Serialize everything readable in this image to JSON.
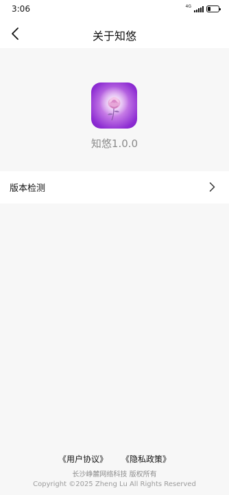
{
  "status_bar": {
    "time": "3:06",
    "network_label": "4G",
    "icons": [
      "signal-icon",
      "battery-icon"
    ],
    "battery_level": 0.25
  },
  "nav": {
    "title": "关于知悠",
    "back_icon": "chevron-left-icon"
  },
  "app": {
    "icon": "rose-app-icon",
    "version_text": "知悠1.0.0"
  },
  "menu": {
    "items": [
      {
        "label": "版本检测",
        "icon": "chevron-right-icon"
      }
    ]
  },
  "footer": {
    "user_agreement": "《用户协议》",
    "privacy_policy": "《隐私政策》",
    "company": "长沙峥麓网络科技 版权所有",
    "copyright": "Copyright ©2025 Zheng Lu All Rights Reserved"
  },
  "colors": {
    "background": "#f7f7f7",
    "surface": "#ffffff",
    "icon_purple": "#8d2cd2",
    "secondary_text": "#8a8a8a"
  }
}
